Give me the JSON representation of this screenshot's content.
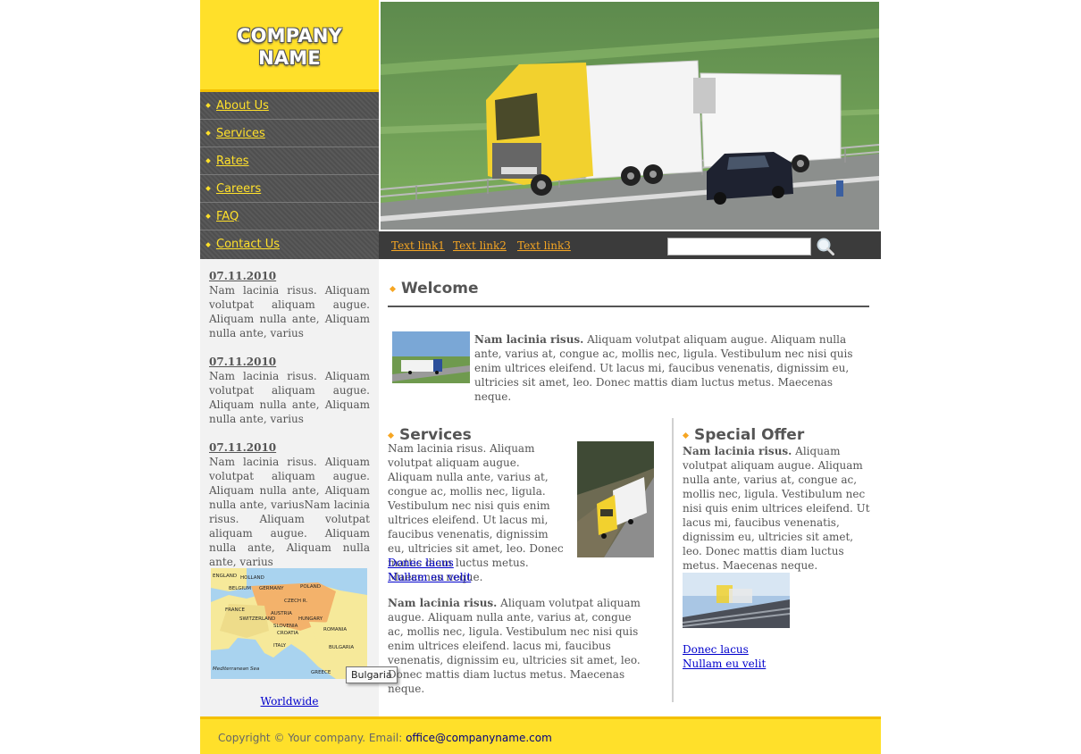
{
  "logo": {
    "line1": "COMPANY",
    "line2": "NAME"
  },
  "nav": [
    "About Us",
    "Services",
    "Rates",
    "Careers",
    "FAQ",
    "Contact Us"
  ],
  "top_links": [
    "Text link1",
    "Text link2",
    "Text link3"
  ],
  "search": {
    "value": ""
  },
  "news": [
    {
      "date": "07.11.2010",
      "text": "Nam lacinia risus. Aliquam volutpat aliquam augue. Aliquam nulla ante, Aliquam nulla ante, varius"
    },
    {
      "date": "07.11.2010",
      "text": "Nam lacinia risus. Aliquam volutpat aliquam augue. Aliquam nulla ante, Aliquam nulla ante, varius"
    },
    {
      "date": "07.11.2010",
      "text": "Nam lacinia risus. Aliquam volutpat aliquam augue. Aliquam nulla ante, Aliquam nulla ante, variusNam lacinia risus. Aliquam volutpat aliquam augue. Aliquam nulla ante, Aliquam nulla ante, varius"
    }
  ],
  "map": {
    "labels": [
      "ENGLAND",
      "HOLLAND",
      "BELGIUM",
      "GERMANY",
      "POLAND",
      "CZECH R.",
      "FRANCE",
      "AUSTRIA",
      "SWITZERLAND",
      "HUNGARY",
      "SLOVENIA",
      "CROATIA",
      "ROMANIA",
      "ITALY",
      "BULGARIA",
      "GREECE",
      "Mediterranean Sea"
    ],
    "link": "Worldwide",
    "tooltip": "Bulgaria"
  },
  "welcome": {
    "heading": "Welcome",
    "bold": "Nam lacinia risus.",
    "text": " Aliquam volutpat aliquam augue. Aliquam nulla ante, varius at, congue ac, mollis nec, ligula. Vestibulum nec nisi quis enim ultrices eleifend. Ut lacus mi, faucibus venenatis, dignissim eu, ultricies sit amet, leo. Donec mattis diam luctus metus. Maecenas neque."
  },
  "services": {
    "heading": "Services",
    "text": "Nam lacinia risus. Aliquam volutpat aliquam augue. Aliquam nulla ante, varius at, congue ac, mollis nec, ligula. Vestibulum nec nisi quis enim ultrices eleifend. Ut lacus mi, faucibus venenatis, dignissim eu, ultricies sit amet, leo. Donec mattis diam luctus metus. Maecenas neque.",
    "link1": "Donec lacus",
    "link2": "Nullam eu velit",
    "para2_bold": "Nam lacinia risus.",
    "para2_text": " Aliquam volutpat aliquam augue. Aliquam nulla ante, varius at, congue ac, mollis nec, ligula. Vestibulum nec nisi quis enim ultrices eleifend. lacus mi, faucibus venenatis, dignissim eu, ultricies sit amet, leo. Donec mattis diam luctus metus. Maecenas neque."
  },
  "offer": {
    "heading": "Special Offer",
    "bold": "Nam lacinia risus.",
    "text": " Aliquam volutpat aliquam augue. Aliquam nulla ante, varius at, congue ac, mollis nec, ligula. Vestibulum nec nisi quis enim ultrices eleifend. Ut lacus mi, faucibus venenatis, dignissim eu, ultricies sit amet, leo. Donec mattis diam luctus metus. Maecenas neque.",
    "link1": "Donec lacus",
    "link2": "Nullam eu velit"
  },
  "footer": {
    "text": "Copyright © Your company. Email: ",
    "email": "office@companyname.com"
  },
  "colors": {
    "yellow": "#ffe02a",
    "dark": "#3b3b3b",
    "link_orange": "#f6a623",
    "link_blue": "#0000cc"
  }
}
